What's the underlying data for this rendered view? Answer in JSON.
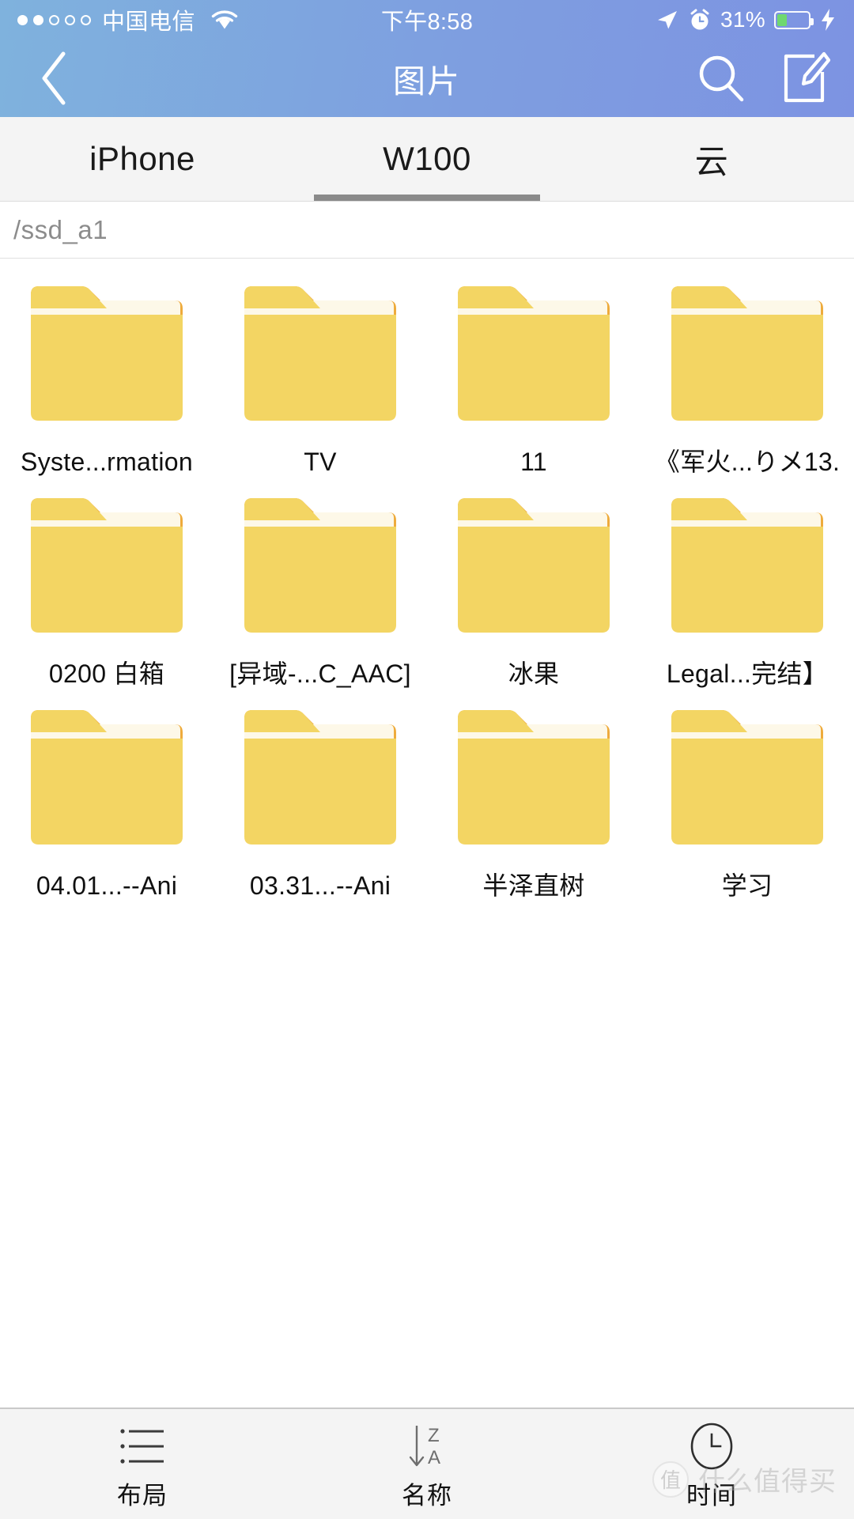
{
  "status_bar": {
    "signal_dots_total": 5,
    "signal_dots_filled": 2,
    "carrier": "中国电信",
    "wifi_icon": "wifi-icon",
    "time": "下午8:58",
    "location_icon": "location-arrow-icon",
    "alarm_icon": "alarm-clock-icon",
    "battery_percent": "31%",
    "battery_level": 31,
    "battery_fill_color": "#6fd86f",
    "charging_icon": "lightning-bolt-icon"
  },
  "nav_bar": {
    "back_icon": "chevron-left-icon",
    "title": "图片",
    "search_icon": "search-icon",
    "compose_icon": "compose-icon",
    "gradient_start": "#7fb2dd",
    "gradient_end": "#7d93e2"
  },
  "tabs": {
    "active_index": 1,
    "items": [
      {
        "label": "iPhone"
      },
      {
        "label": "W100"
      },
      {
        "label": "云"
      }
    ],
    "underline_color": "#8a8a8a"
  },
  "path_bar": {
    "path": "/ssd_a1"
  },
  "grid": {
    "folder_colors": {
      "body": "#f3d563",
      "tab_edge": "#eeab3c",
      "paper": "#fdf8e8"
    },
    "items": [
      {
        "label": "Syste...rmation",
        "icon": "folder-icon"
      },
      {
        "label": "TV",
        "icon": "folder-icon"
      },
      {
        "label": "11",
        "icon": "folder-icon"
      },
      {
        "label": "《军火...りメ13.",
        "icon": "folder-icon"
      },
      {
        "label": "0200 白箱",
        "icon": "folder-icon"
      },
      {
        "label": "[异域-...C_AAC]",
        "icon": "folder-icon"
      },
      {
        "label": "冰果",
        "icon": "folder-icon"
      },
      {
        "label": "Legal...完结】",
        "icon": "folder-icon"
      },
      {
        "label": "04.01...--Ani",
        "icon": "folder-icon"
      },
      {
        "label": "03.31...--Ani",
        "icon": "folder-icon"
      },
      {
        "label": "半泽直树",
        "icon": "folder-icon"
      },
      {
        "label": "学习",
        "icon": "folder-icon"
      }
    ]
  },
  "bottom_bar": {
    "items": [
      {
        "label": "布局",
        "icon": "list-layout-icon"
      },
      {
        "label": "名称",
        "icon": "sort-za-icon"
      },
      {
        "label": "时间",
        "icon": "clock-icon"
      }
    ]
  },
  "watermark": {
    "text": "什么值得买",
    "mark": "值"
  }
}
